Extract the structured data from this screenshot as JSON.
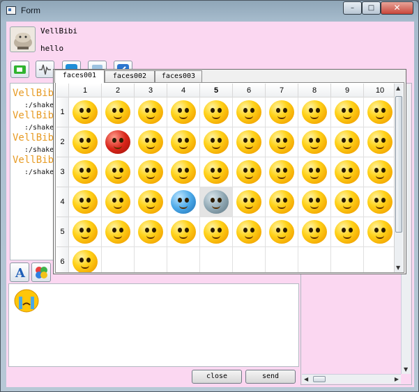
{
  "window": {
    "title": "Form"
  },
  "titlebar_buttons": {
    "minimize": "–",
    "maximize": "□",
    "close": "✕"
  },
  "user": {
    "name": "VellBibi",
    "message": "hello"
  },
  "toolbar_icons": [
    "video-icon",
    "audio-icon",
    "share-icon",
    "file-icon",
    "edit-icon"
  ],
  "chat": [
    {
      "name": "VellBibi",
      "text": ":/shake"
    },
    {
      "name": "VellBibi",
      "text": ":/shake"
    },
    {
      "name": "VellBibi",
      "text": ":/shake"
    },
    {
      "name": "VellBibi",
      "text": ":/shake"
    }
  ],
  "format_icons": [
    "font-icon",
    "color-icon"
  ],
  "buttons": {
    "close": "close",
    "send": "send"
  },
  "emoji_picker": {
    "tabs": [
      "faces001",
      "faces002",
      "faces003"
    ],
    "active_tab": "faces001",
    "columns": [
      "1",
      "2",
      "3",
      "4",
      "5",
      "6",
      "7",
      "8",
      "9",
      "10"
    ],
    "rows": [
      "1",
      "2",
      "3",
      "4",
      "5",
      "6"
    ],
    "selected_column": "5",
    "selected_cell": "row 4, column 5",
    "faces_per_row": [
      10,
      10,
      10,
      10,
      10,
      1
    ]
  },
  "colors": {
    "panel_bg": "#fbd7f1",
    "chat_name": "#e79b24",
    "face_yellow": "#ffd21a"
  }
}
